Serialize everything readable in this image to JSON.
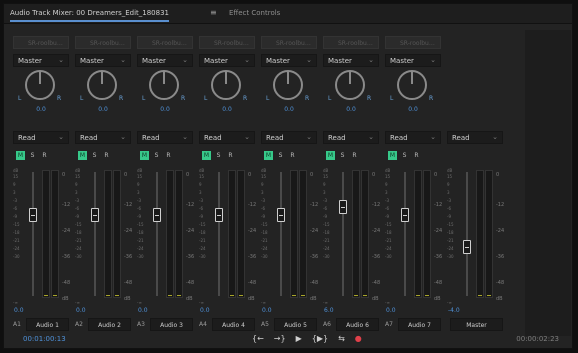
{
  "tabs": [
    {
      "label": "Audio Track Mixer: 00 Dreamers_Edit_180831",
      "active": true
    },
    {
      "label": "Effect Controls",
      "active": false
    }
  ],
  "tab_menu_icon": "hamburger-menu-icon",
  "channels": [
    {
      "id": "A1",
      "name": "Audio 1",
      "slot": "SR-roolbu…",
      "routing": "Master",
      "automation": "Read",
      "pan_l": "L",
      "pan_r": "R",
      "pan_value": "0.0",
      "volume": "0.0",
      "mute": "M",
      "solo": "S",
      "record": "R"
    },
    {
      "id": "A2",
      "name": "Audio 2",
      "slot": "SR-roolbu…",
      "routing": "Master",
      "automation": "Read",
      "pan_l": "L",
      "pan_r": "R",
      "pan_value": "0.0",
      "volume": "0.0",
      "mute": "M",
      "solo": "S",
      "record": "R"
    },
    {
      "id": "A3",
      "name": "Audio 3",
      "slot": "SR-roolbu…",
      "routing": "Master",
      "automation": "Read",
      "pan_l": "L",
      "pan_r": "R",
      "pan_value": "0.0",
      "volume": "0.0",
      "mute": "M",
      "solo": "S",
      "record": "R"
    },
    {
      "id": "A4",
      "name": "Audio 4",
      "slot": "SR-roolbu…",
      "routing": "Master",
      "automation": "Read",
      "pan_l": "L",
      "pan_r": "R",
      "pan_value": "0.0",
      "volume": "0.0",
      "mute": "M",
      "solo": "S",
      "record": "R"
    },
    {
      "id": "A5",
      "name": "Audio 5",
      "slot": "SR-roolbu…",
      "routing": "Master",
      "automation": "Read",
      "pan_l": "L",
      "pan_r": "R",
      "pan_value": "0.0",
      "volume": "0.0",
      "mute": "M",
      "solo": "S",
      "record": "R"
    },
    {
      "id": "A6",
      "name": "Audio 6",
      "slot": "SR-roolbu…",
      "routing": "Master",
      "automation": "Read",
      "pan_l": "L",
      "pan_r": "R",
      "pan_value": "0.0",
      "volume": "6.0",
      "mute": "M",
      "solo": "S",
      "record": "R"
    },
    {
      "id": "A7",
      "name": "Audio 7",
      "slot": "SR-roolbu…",
      "routing": "Master",
      "automation": "Read",
      "pan_l": "L",
      "pan_r": "R",
      "pan_value": "0.0",
      "volume": "0.0",
      "mute": "M",
      "solo": "S",
      "record": "R"
    }
  ],
  "master": {
    "name": "Master",
    "automation": "Read",
    "volume": "-4.0"
  },
  "db_scale_left": [
    "dB",
    "15",
    "9",
    "3",
    "-3",
    "-6",
    "-9",
    "-15",
    "-18",
    "-21",
    "-24",
    "-30",
    "-∞"
  ],
  "db_scale_right": [
    "0",
    "-12",
    "-24",
    "-36",
    "-48",
    "dB"
  ],
  "footer": {
    "timecode_current": "00:01:00:13",
    "timecode_duration": "00:00:02:23",
    "transport": [
      "go-to-in-point-icon",
      "go-to-out-point-icon",
      "play-icon",
      "play-in-to-out-icon",
      "loop-icon",
      "record-icon"
    ],
    "transport_glyphs": [
      "{←",
      "→}",
      "▶",
      "{▶}",
      "⇆",
      "●"
    ]
  },
  "colors": {
    "accent_blue": "#4f91d8",
    "mute_green": "#37c98a",
    "record_red": "#e0404a",
    "meter_floor": "#a9a62a"
  }
}
